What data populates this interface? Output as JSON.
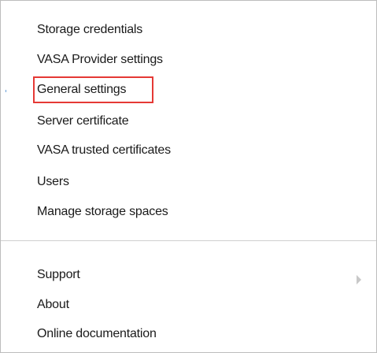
{
  "menu": {
    "items": [
      {
        "label": "Storage credentials"
      },
      {
        "label": "VASA Provider settings"
      },
      {
        "label": "General settings",
        "highlighted": true
      },
      {
        "label": "Server certificate"
      },
      {
        "label": "VASA trusted certificates"
      },
      {
        "label": "Users"
      },
      {
        "label": "Manage storage spaces"
      }
    ],
    "secondary_items": [
      {
        "label": "Support",
        "icon": "chevron-right-icon"
      },
      {
        "label": "About"
      },
      {
        "label": "Online documentation"
      }
    ],
    "highlight_color": "#e53935"
  }
}
